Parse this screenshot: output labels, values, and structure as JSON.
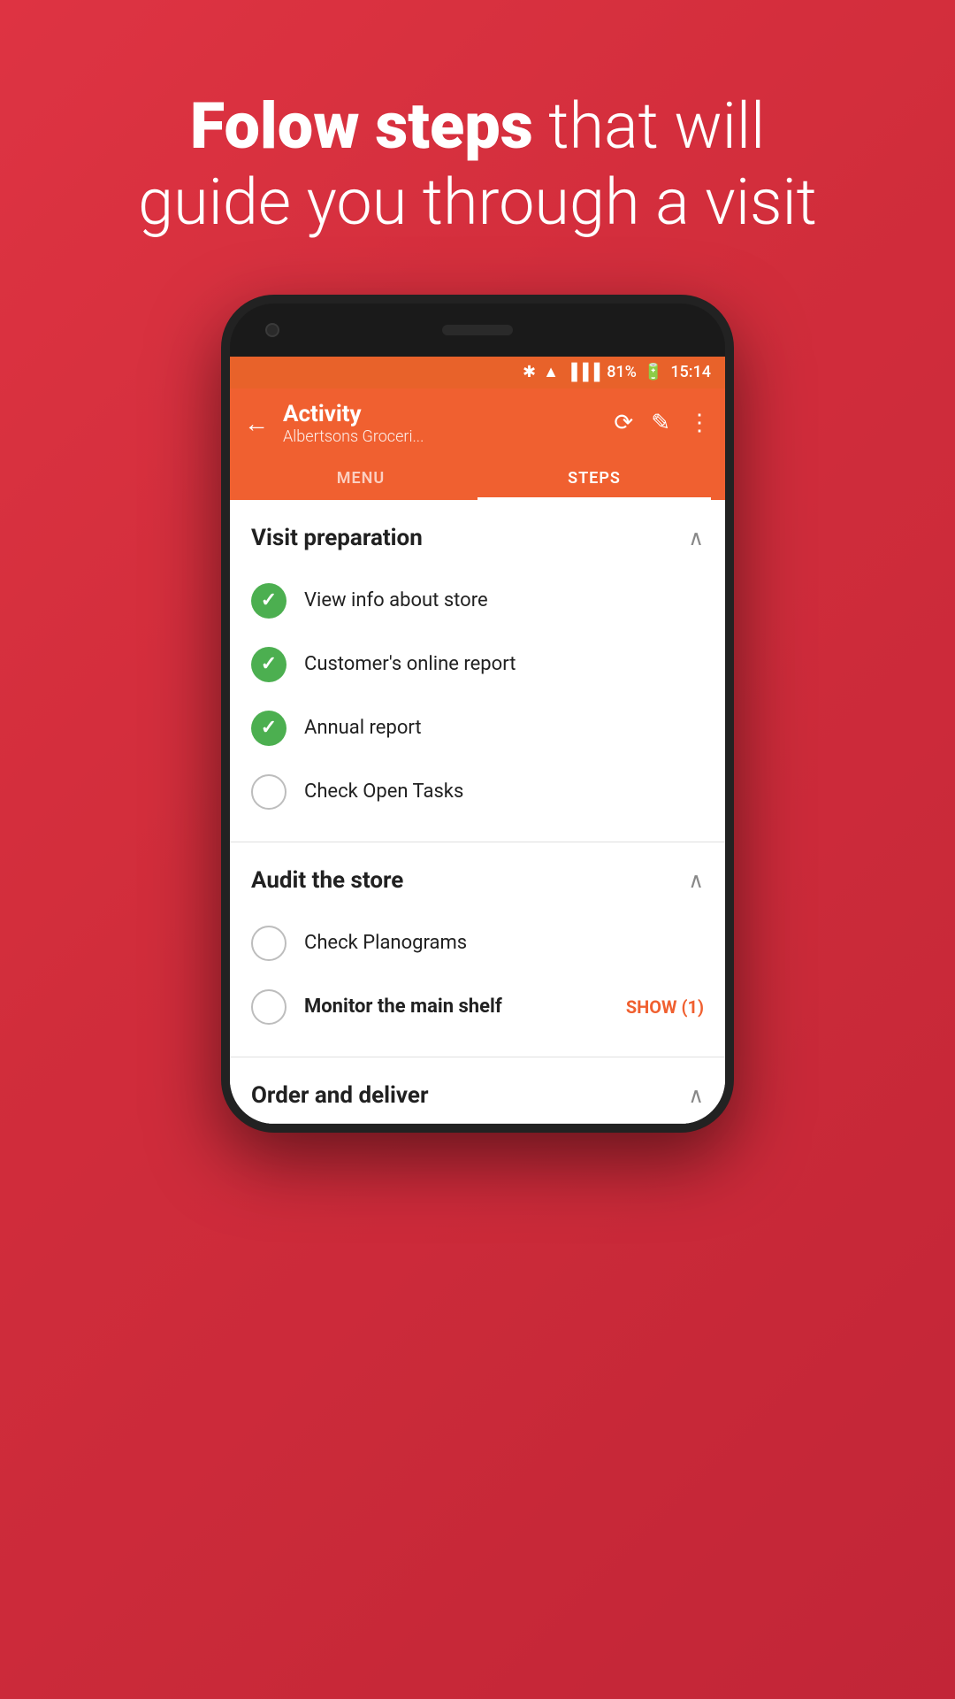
{
  "headline": {
    "bold": "Folow steps",
    "rest": " that will\nguide you through a visit"
  },
  "status_bar": {
    "battery": "81%",
    "time": "15:14"
  },
  "app_bar": {
    "title": "Activity",
    "subtitle": "Albertsons Groceri...",
    "tabs": [
      {
        "label": "MENU",
        "active": false
      },
      {
        "label": "STEPS",
        "active": true
      }
    ]
  },
  "sections": [
    {
      "title": "Visit preparation",
      "expanded": true,
      "items": [
        {
          "label": "View info about store",
          "checked": true,
          "bold": false,
          "show": null
        },
        {
          "label": "Customer's online report",
          "checked": true,
          "bold": false,
          "show": null
        },
        {
          "label": "Annual report",
          "checked": true,
          "bold": false,
          "show": null
        },
        {
          "label": "Check Open Tasks",
          "checked": false,
          "bold": false,
          "show": null
        }
      ]
    },
    {
      "title": "Audit the store",
      "expanded": true,
      "items": [
        {
          "label": "Check Planograms",
          "checked": false,
          "bold": false,
          "show": null
        },
        {
          "label": "Monitor the main shelf",
          "checked": false,
          "bold": true,
          "show": "SHOW (1)"
        }
      ]
    },
    {
      "title": "Order and deliver",
      "expanded": true,
      "items": []
    }
  ],
  "icons": {
    "back": "←",
    "history": "⟳",
    "edit": "✎",
    "more": "⋮",
    "chevron_up": "∧",
    "checkmark": "✓",
    "bluetooth": "✱",
    "wifi": "▲",
    "signal": "▐"
  }
}
